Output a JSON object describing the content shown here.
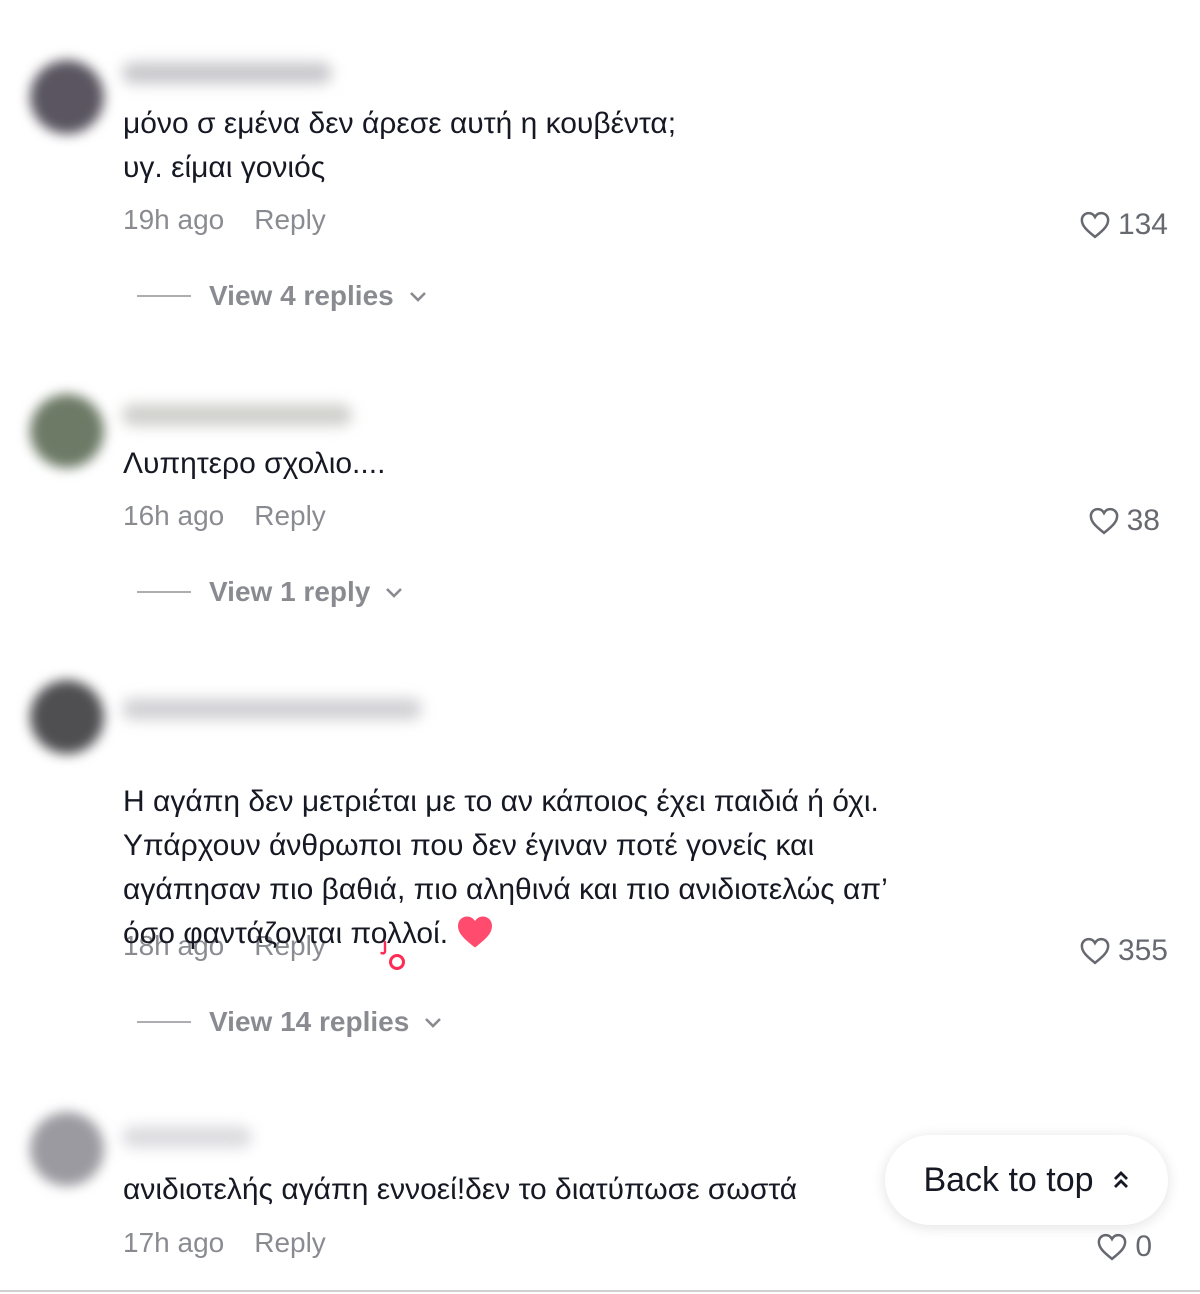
{
  "comments": [
    {
      "text": "μόνο σ εμένα δεν άρεσε αυτή η κουβέντα;\nυγ. είμαι γονιός",
      "time": "19h ago",
      "reply_label": "Reply",
      "likes": "134",
      "view_replies": "View 4 replies",
      "avatar_color": "#5a5560"
    },
    {
      "text": "Λυπητερο σχολιο....",
      "time": "16h ago",
      "reply_label": "Reply",
      "likes": "38",
      "view_replies": "View 1 reply",
      "avatar_color": "#6d7a66"
    },
    {
      "text": "Η αγάπη δεν μετριέται με το αν κάποιος έχει παιδιά ή όχι.\nΥπάρχουν άνθρωποι που δεν έγιναν ποτέ γονείς και\nαγάπησαν πιο βαθιά, πιο αληθινά και πιο ανιδιοτελώς απ’\nόσο φαντάζονται πολλοί.",
      "time": "18h ago",
      "reply_label": "Reply",
      "likes": "355",
      "view_replies": "View 14 replies",
      "avatar_color": "#4f4f52"
    },
    {
      "text": "ανιδιοτελής αγάπη εννοεί!δεν το διατύπωσε σωστά",
      "time": "17h ago",
      "reply_label": "Reply",
      "likes": "0",
      "avatar_color": "#9a9aa0"
    }
  ],
  "back_to_top": "Back to top",
  "colors": {
    "heart_emoji": "#fe2c55",
    "creator_badge": "#fe2c55"
  }
}
